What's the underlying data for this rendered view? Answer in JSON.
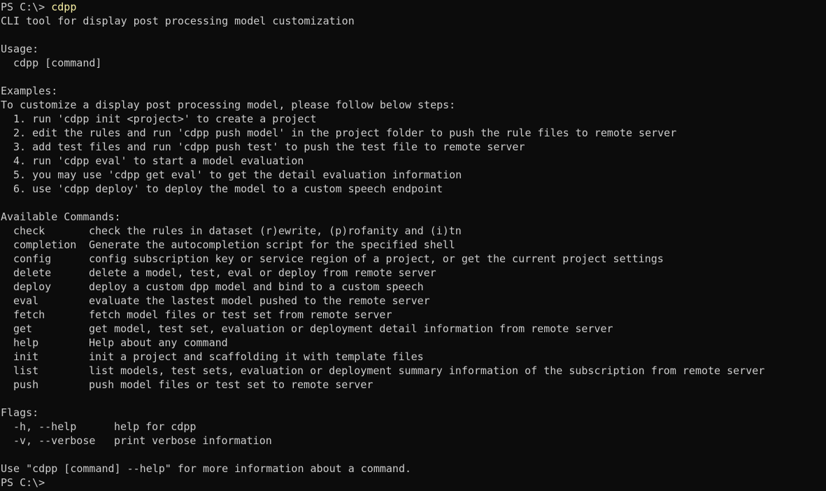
{
  "colors": {
    "background": "#0c0c0c",
    "text": "#cccccc",
    "command": "#f9f1a5"
  },
  "session": {
    "prompt": "PS C:\\> ",
    "command": "cdpp",
    "final_prompt": "PS C:\\>"
  },
  "output": {
    "description": "CLI tool for display post processing model customization",
    "usage_header": "Usage:",
    "usage_line": "cdpp [command]",
    "examples_header": "Examples:",
    "examples_intro": "To customize a display post processing model, please follow below steps:",
    "steps": [
      "1. run 'cdpp init <project>' to create a project",
      "2. edit the rules and run 'cdpp push model' in the project folder to push the rule files to remote server",
      "3. add test files and run 'cdpp push test' to push the test file to remote server",
      "4. run 'cdpp eval' to start a model evaluation",
      "5. you may use 'cdpp get eval' to get the detail evaluation information",
      "6. use 'cdpp deploy' to deploy the model to a custom speech endpoint"
    ],
    "commands_header": "Available Commands:",
    "commands": [
      {
        "name": "check",
        "desc": "check the rules in dataset (r)ewrite, (p)rofanity and (i)tn"
      },
      {
        "name": "completion",
        "desc": "Generate the autocompletion script for the specified shell"
      },
      {
        "name": "config",
        "desc": "config subscription key or service region of a project, or get the current project settings"
      },
      {
        "name": "delete",
        "desc": "delete a model, test, eval or deploy from remote server"
      },
      {
        "name": "deploy",
        "desc": "deploy a custom dpp model and bind to a custom speech"
      },
      {
        "name": "eval",
        "desc": "evaluate the lastest model pushed to the remote server"
      },
      {
        "name": "fetch",
        "desc": "fetch model files or test set from remote server"
      },
      {
        "name": "get",
        "desc": "get model, test set, evaluation or deployment detail information from remote server"
      },
      {
        "name": "help",
        "desc": "Help about any command"
      },
      {
        "name": "init",
        "desc": "init a project and scaffolding it with template files"
      },
      {
        "name": "list",
        "desc": "list models, test sets, evaluation or deployment summary information of the subscription from remote server"
      },
      {
        "name": "push",
        "desc": "push model files or test set to remote server"
      }
    ],
    "flags_header": "Flags:",
    "flags": [
      {
        "name": "-h, --help",
        "desc": "help for cdpp"
      },
      {
        "name": "-v, --verbose",
        "desc": "print verbose information"
      }
    ],
    "footer": "Use \"cdpp [command] --help\" for more information about a command."
  }
}
